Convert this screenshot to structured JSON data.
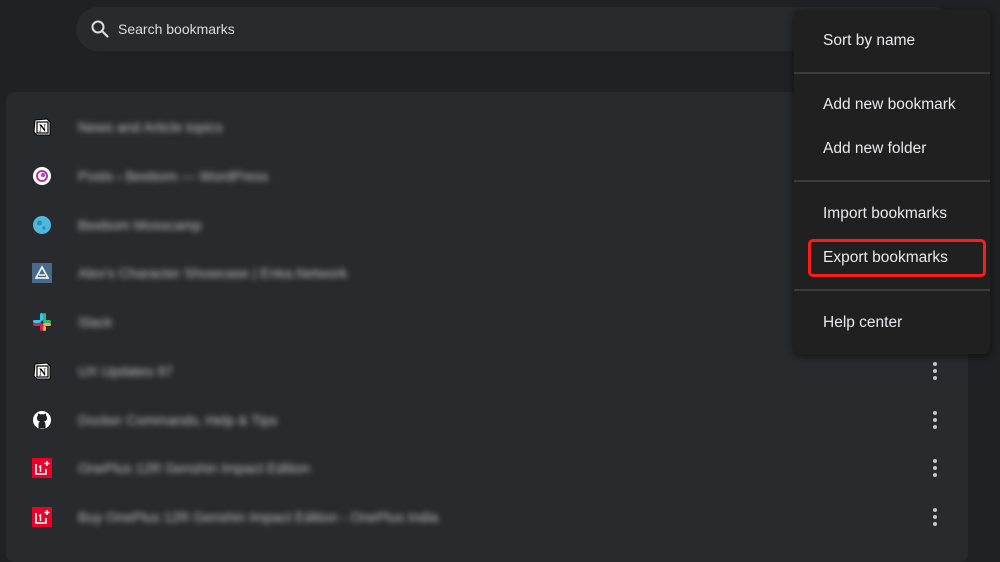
{
  "search": {
    "placeholder": "Search bookmarks",
    "icon": "search-icon"
  },
  "bookmarks": [
    {
      "title": "News and Article topics",
      "icon": "notion-icon"
    },
    {
      "title": "Posts ‹ Beebom — WordPress",
      "icon": "wordpress-app-icon"
    },
    {
      "title": "Beebom Mosscamp",
      "icon": "basecamp-globe-icon"
    },
    {
      "title": "Alex's Character Showcase | Enka.Network",
      "icon": "enka-network-icon"
    },
    {
      "title": "Slack",
      "icon": "slack-icon"
    },
    {
      "title": "UX Updates 97",
      "icon": "notion-icon"
    },
    {
      "title": "Docker Commands, Help & Tips",
      "icon": "github-icon"
    },
    {
      "title": "OnePlus 12R Genshin Impact Edition",
      "icon": "oneplus-icon"
    },
    {
      "title": "Buy OnePlus 12R Genshin Impact Edition - OnePlus India",
      "icon": "oneplus-icon"
    }
  ],
  "menu": {
    "items": [
      {
        "label": "Sort by name"
      },
      {
        "label": "Add new bookmark"
      },
      {
        "label": "Add new folder"
      },
      {
        "label": "Import bookmarks"
      },
      {
        "label": "Export bookmarks",
        "highlighted": true
      },
      {
        "label": "Help center"
      }
    ]
  },
  "colors": {
    "background": "#202124",
    "card": "#292a2d",
    "menu": "#202020",
    "highlight": "#ff1a1a",
    "oneplus_red": "#eb0028"
  }
}
